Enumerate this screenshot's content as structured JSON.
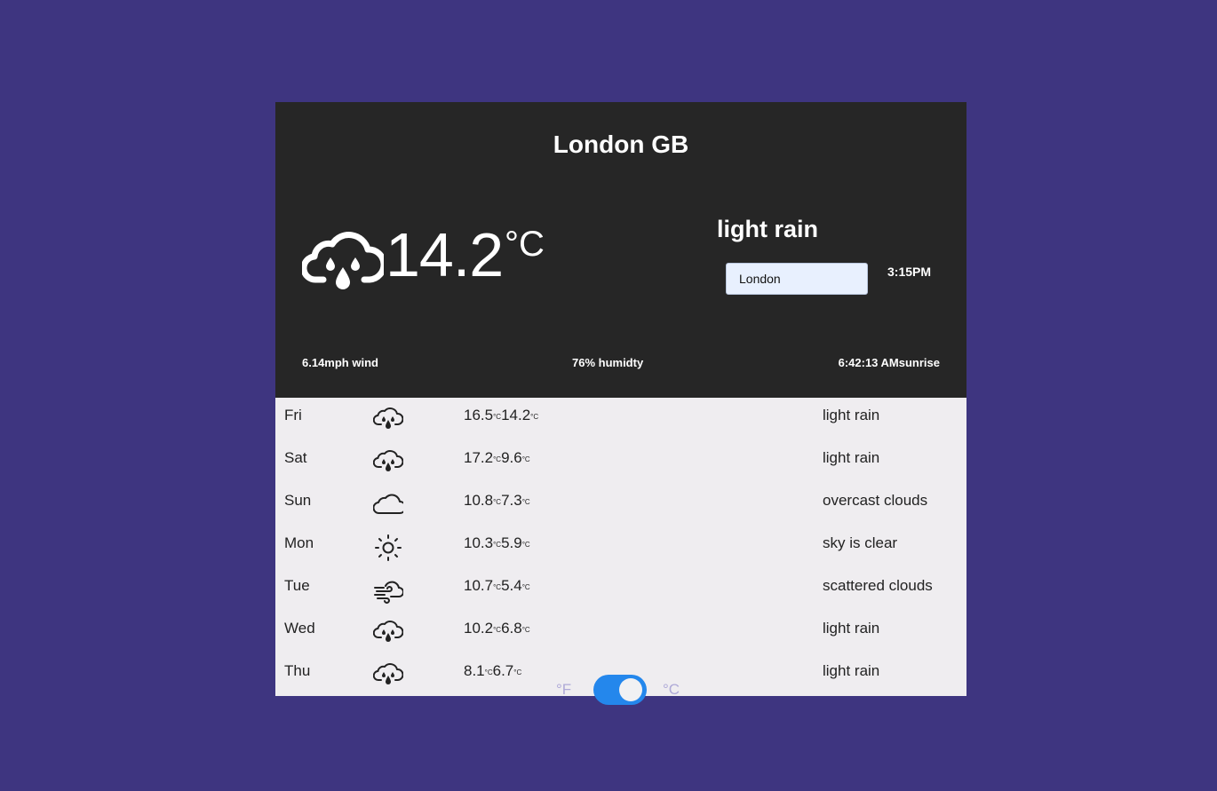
{
  "current": {
    "city": "London GB",
    "temperature": "14.2",
    "unit": "°C",
    "icon": "cloud-rain-icon",
    "description": "light rain",
    "time": "3:15PM",
    "wind": "6.14mph wind",
    "humidity": "76% humidty",
    "sunrise": "6:42:13 AMsunrise"
  },
  "search": {
    "value": "London"
  },
  "forecast": [
    {
      "day": "Fri",
      "icon": "cloud-rain-icon",
      "high": "16.5",
      "low": "14.2",
      "unit": "°C",
      "cond": "light rain"
    },
    {
      "day": "Sat",
      "icon": "cloud-rain-icon",
      "high": "17.2",
      "low": "9.6",
      "unit": "°C",
      "cond": "light rain"
    },
    {
      "day": "Sun",
      "icon": "cloud-icon",
      "high": "10.8",
      "low": "7.3",
      "unit": "°C",
      "cond": "overcast clouds"
    },
    {
      "day": "Mon",
      "icon": "sun-icon",
      "high": "10.3",
      "low": "5.9",
      "unit": "°C",
      "cond": "sky is clear"
    },
    {
      "day": "Tue",
      "icon": "windy-cloud-icon",
      "high": "10.7",
      "low": "5.4",
      "unit": "°C",
      "cond": "scattered clouds"
    },
    {
      "day": "Wed",
      "icon": "cloud-rain-icon",
      "high": "10.2",
      "low": "6.8",
      "unit": "°C",
      "cond": "light rain"
    },
    {
      "day": "Thu",
      "icon": "cloud-rain-icon",
      "high": "8.1",
      "low": "6.7",
      "unit": "°C",
      "cond": "light rain"
    }
  ],
  "toggle": {
    "left_label": "°F",
    "right_label": "°C",
    "state": "celsius"
  },
  "colors": {
    "background": "#3e3580",
    "header": "#262626",
    "panel": "#efedf0",
    "accent": "#2487ec"
  }
}
